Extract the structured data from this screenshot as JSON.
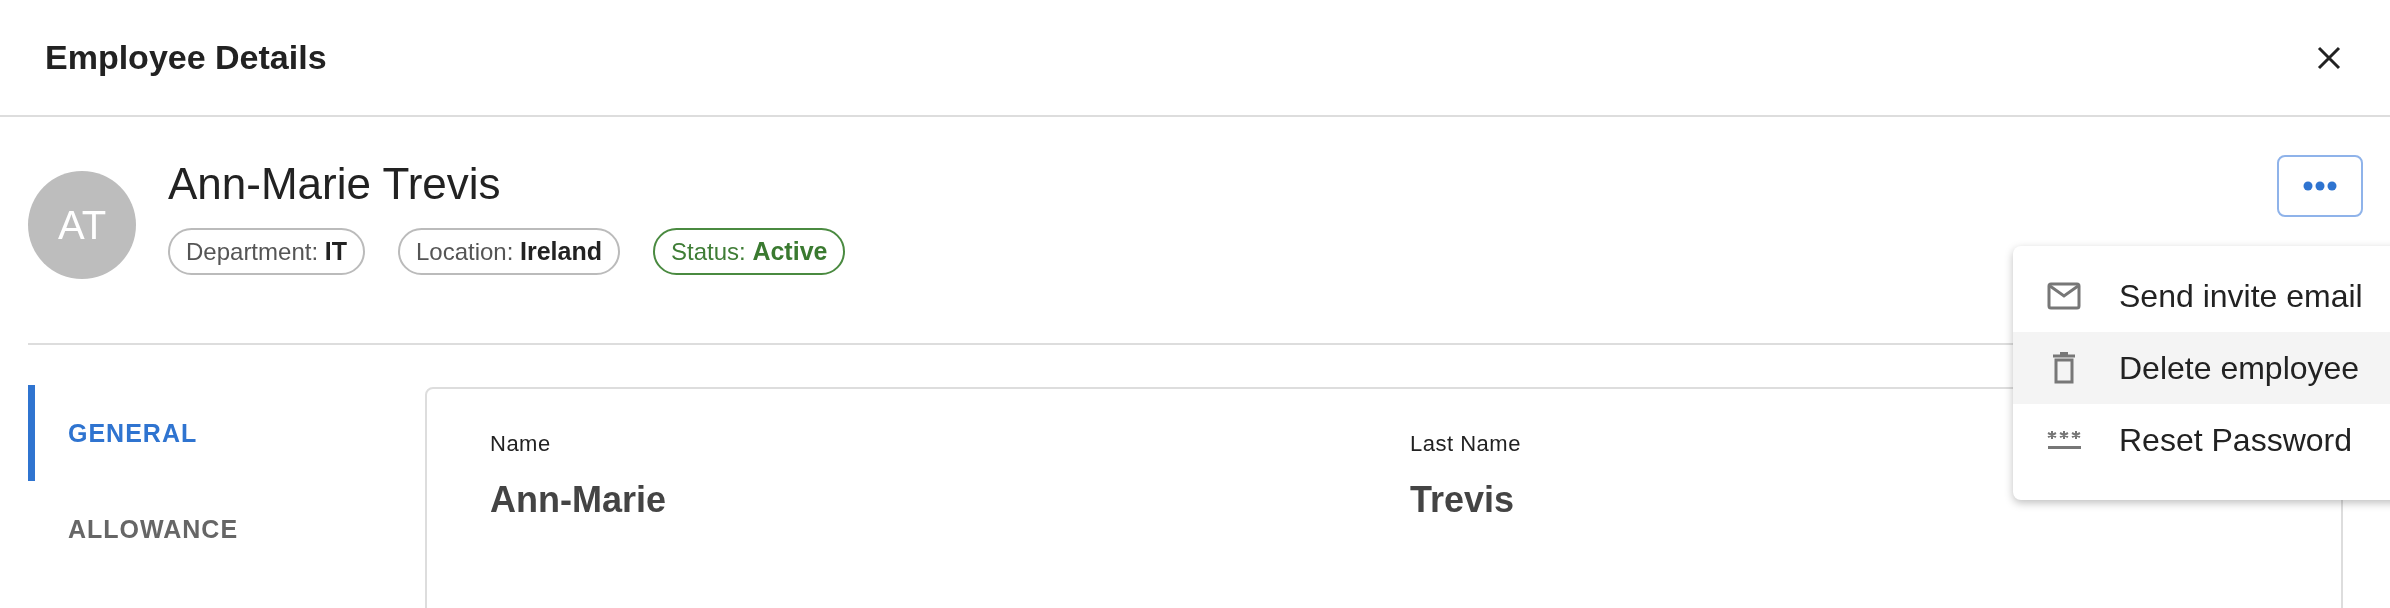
{
  "dialog": {
    "title": "Employee Details"
  },
  "employee": {
    "initials": "AT",
    "name": "Ann-Marie Trevis",
    "chips": [
      {
        "label": "Department:",
        "value": "IT",
        "kind": "neutral"
      },
      {
        "label": "Location:",
        "value": "Ireland",
        "kind": "neutral"
      },
      {
        "label": "Status:",
        "value": "Active",
        "kind": "success"
      }
    ]
  },
  "actions_menu": {
    "open": true,
    "items": [
      {
        "label": "Send invite email",
        "kind": "email",
        "highlighted": false
      },
      {
        "label": "Delete employee",
        "kind": "delete",
        "highlighted": true
      },
      {
        "label": "Reset Password",
        "kind": "password",
        "highlighted": false
      }
    ]
  },
  "tabs": [
    {
      "label": "GENERAL",
      "selected": true
    },
    {
      "label": "ALLOWANCE",
      "selected": false
    }
  ],
  "fields": [
    {
      "label": "Name",
      "value": "Ann-Marie"
    },
    {
      "label": "Last Name",
      "value": "Trevis"
    }
  ]
}
